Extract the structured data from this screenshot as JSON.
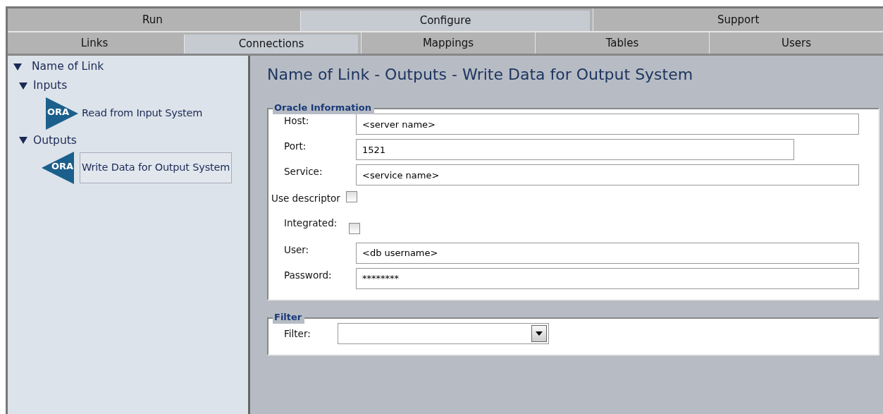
{
  "main_tabs": [
    {
      "label": "Run",
      "selected": false
    },
    {
      "label": "Configure",
      "selected": true
    },
    {
      "label": "Support",
      "selected": false
    }
  ],
  "sub_tabs": [
    {
      "label": "Links",
      "selected": false
    },
    {
      "label": "Connections",
      "selected": true
    },
    {
      "label": "Mappings",
      "selected": false
    },
    {
      "label": "Tables",
      "selected": false
    },
    {
      "label": "Users",
      "selected": false
    }
  ],
  "tree": [
    {
      "label": "Name of Link",
      "expanded": true,
      "children": [
        {
          "label": "Inputs",
          "expanded": true,
          "children": [
            {
              "label": "Read from Input System",
              "icon_text": "ORA",
              "kind": "input",
              "selected": false
            }
          ]
        },
        {
          "label": "Outputs",
          "expanded": true,
          "children": [
            {
              "label": "Write Data for Output System",
              "icon_text": "ORA",
              "kind": "output",
              "selected": true
            }
          ]
        }
      ]
    }
  ],
  "page_title": "Name of Link - Outputs - Write Data for Output System",
  "sections": [
    {
      "legend": "Oracle Information",
      "fields": [
        {
          "kind": "text",
          "label": "Host:",
          "value": "<server name>",
          "wide": true
        },
        {
          "kind": "text",
          "label": "Port:",
          "value": "1521",
          "wide": false
        },
        {
          "kind": "text",
          "label": "Service:",
          "value": "<service name>",
          "wide": true
        },
        {
          "kind": "inline-check",
          "label": "Use descriptor",
          "checked": false
        },
        {
          "kind": "check",
          "label": "Integrated:",
          "checked": false
        },
        {
          "kind": "text",
          "label": "User:",
          "value": "<db username>",
          "wide": true
        },
        {
          "kind": "text",
          "label": "Password:",
          "value": "********",
          "wide": true
        }
      ]
    },
    {
      "legend": "Filter",
      "fields": [
        {
          "kind": "select",
          "label": "Filter:"
        }
      ]
    }
  ]
}
